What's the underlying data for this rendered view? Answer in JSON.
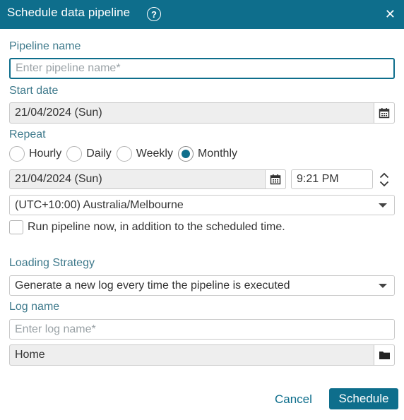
{
  "dialog": {
    "title": "Schedule data pipeline",
    "help_icon": "question-circle-icon",
    "close_icon": "close-icon",
    "accent_color": "#0e6e8c"
  },
  "pipeline_name": {
    "label": "Pipeline name",
    "value": "",
    "placeholder": "Enter pipeline name*"
  },
  "start_date": {
    "label": "Start date",
    "value": "21/04/2024 (Sun)",
    "icon": "calendar-icon"
  },
  "repeat": {
    "label": "Repeat",
    "options": [
      "Hourly",
      "Daily",
      "Weekly",
      "Monthly"
    ],
    "selected": "Monthly",
    "date_value": "21/04/2024 (Sun)",
    "time_value": "9:21 PM",
    "timezone": "(UTC+10:00) Australia/Melbourne"
  },
  "run_now": {
    "label": "Run pipeline now, in addition to the scheduled time.",
    "checked": false
  },
  "loading_strategy": {
    "label": "Loading Strategy",
    "value": "Generate a new log every time the pipeline is executed"
  },
  "log_name": {
    "label": "Log name",
    "value": "",
    "placeholder": "Enter log name*"
  },
  "location": {
    "value": "Home",
    "icon": "folder-icon"
  },
  "actions": {
    "cancel_label": "Cancel",
    "schedule_label": "Schedule"
  }
}
